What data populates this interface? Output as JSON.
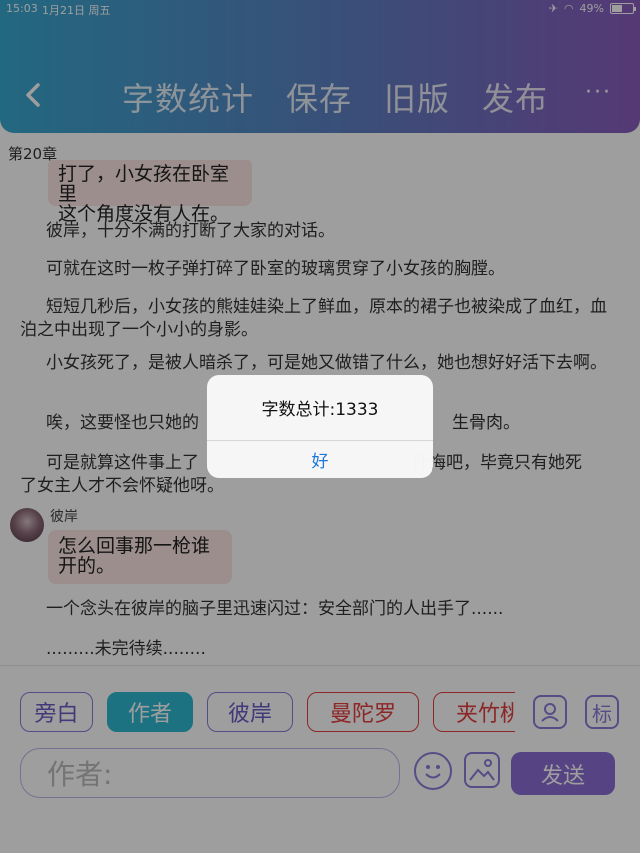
{
  "status_bar": {
    "time": "15:03",
    "date": "1月21日 周五",
    "battery": "49%",
    "battery_level": 0.49
  },
  "header": {
    "nav": [
      "字数统计",
      "保存",
      "旧版",
      "发布"
    ],
    "more": "···"
  },
  "chapter_title": "第20章",
  "messages": {
    "top_bubble_line1": "打了，小女孩在卧室里",
    "top_bubble_line2": "这个角度没有人在。",
    "p1": "彼岸，十分不满的打断了大家的对话。",
    "p2": "可就在这时一枚子弹打碎了卧室的玻璃贯穿了小女孩的胸膛。",
    "p3": "短短几秒后，小女孩的熊娃娃染上了鲜血，原本的裙子也被染成了血红，血泊之中出现了一个小小的身影。",
    "p4": "小女孩死了，是被人暗杀了，可是她又做错了什么，她也想好好活下去啊。",
    "p5_left": "唉，这要怪也只她的",
    "p5_right": "生骨肉。",
    "p6_left": "可是就算这件事上了",
    "p6_right": "忏悔吧，毕竟只有她死",
    "p6_line2": "了女主人才不会怀疑他呀。",
    "speaker": "彼岸",
    "bubble2": "怎么回事那一枪谁开的。",
    "p7": "一个念头在彼岸的脑子里迅速闪过：安全部门的人出手了......",
    "p8": ".........未完待续........"
  },
  "dialog": {
    "message": "字数总计:1333",
    "ok": "好"
  },
  "composer": {
    "roles": [
      "旁白",
      "作者",
      "彼岸",
      "曼陀罗",
      "夹竹桃"
    ],
    "active_role": "作者",
    "placeholder": "作者:",
    "send": "发送",
    "tag_label": "标"
  }
}
